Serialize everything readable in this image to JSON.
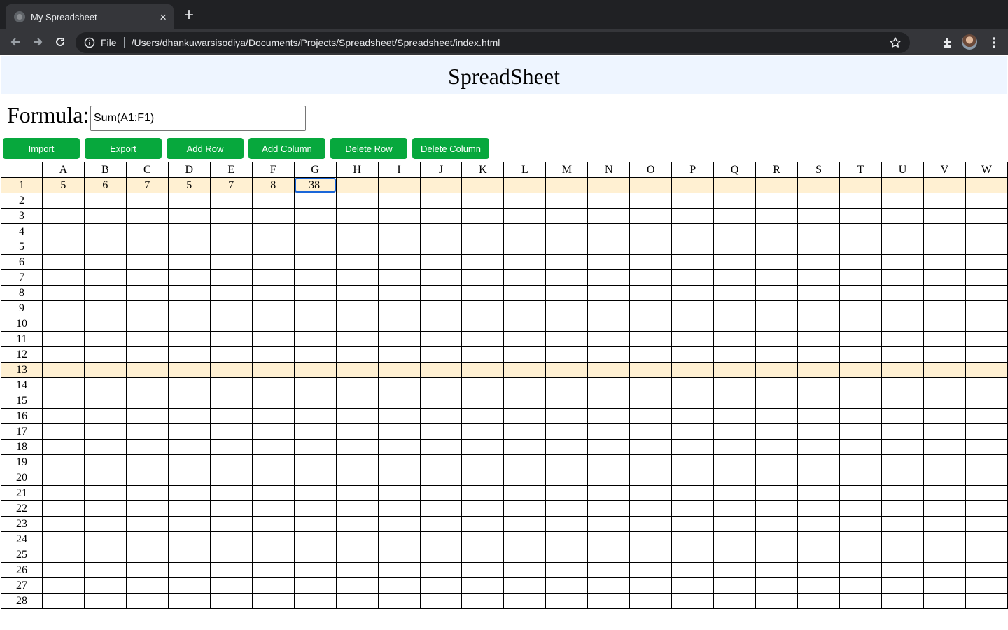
{
  "browser": {
    "tab_title": "My Spreadsheet",
    "new_tab_label": "+",
    "close_label": "×",
    "address_scheme": "File",
    "address_url": "/Users/dhankuwarsisodiya/Documents/Projects/Spreadsheet/Spreadsheet/index.html"
  },
  "app": {
    "title": "SpreadSheet",
    "formula_label": "Formula:",
    "formula_value": "Sum(A1:F1)",
    "buttons": {
      "import": "Import",
      "export": "Export",
      "add_row": "Add Row",
      "add_column": "Add Column",
      "delete_row": "Delete Row",
      "delete_column": "Delete Column"
    },
    "accent_color": "#07a83d",
    "header_bg": "#eef5ff",
    "highlight_row_color": "#fff0d2",
    "selection_color": "#1a66d8"
  },
  "grid": {
    "columns": [
      "A",
      "B",
      "C",
      "D",
      "E",
      "F",
      "G",
      "H",
      "I",
      "J",
      "K",
      "L",
      "M",
      "N",
      "O",
      "P",
      "Q",
      "R",
      "S",
      "T",
      "U",
      "V",
      "W"
    ],
    "row_count": 28,
    "row1_values": [
      "5",
      "6",
      "7",
      "5",
      "7",
      "8",
      "38"
    ],
    "highlighted_rows": [
      1,
      13
    ],
    "selected_cell": "G1"
  }
}
